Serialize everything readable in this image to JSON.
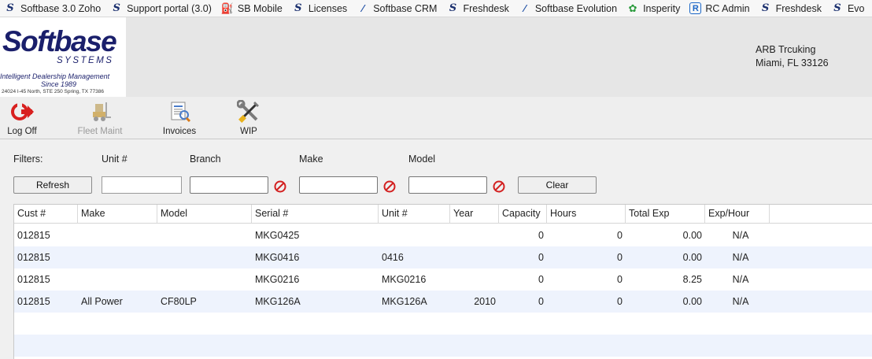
{
  "bookmarks": [
    {
      "label": "Softbase 3.0 Zoho",
      "icon": "softbase-icon"
    },
    {
      "label": "Support portal (3.0)",
      "icon": "softbase-icon"
    },
    {
      "label": "SB Mobile",
      "icon": "forklift-icon"
    },
    {
      "label": "Licenses",
      "icon": "softbase-icon"
    },
    {
      "label": "Softbase CRM",
      "icon": "crm-icon"
    },
    {
      "label": "Freshdesk",
      "icon": "softbase-icon"
    },
    {
      "label": "Softbase Evolution",
      "icon": "crm-icon"
    },
    {
      "label": "Insperity",
      "icon": "insperity-icon"
    },
    {
      "label": "RC Admin",
      "icon": "rc-icon"
    },
    {
      "label": "Freshdesk",
      "icon": "softbase-icon"
    },
    {
      "label": "Evo",
      "icon": "softbase-icon"
    }
  ],
  "logo": {
    "name": "Softbase",
    "subtitle": "SYSTEMS",
    "tagline": "Intelligent Dealership Management",
    "since": "Since 1989",
    "address": "24024 I-45 North, STE 250 Spring, TX 77386"
  },
  "company": {
    "name": "ARB Trcuking",
    "city": "Miami, FL 33126"
  },
  "toolbar": {
    "logoff": "Log Off",
    "fleet_maint": "Fleet Maint",
    "invoices": "Invoices",
    "wip": "WIP"
  },
  "filters": {
    "label": "Filters:",
    "unit_label": "Unit #",
    "branch_label": "Branch",
    "make_label": "Make",
    "model_label": "Model",
    "refresh": "Refresh",
    "clear": "Clear",
    "unit_value": ""
  },
  "table": {
    "columns": [
      "Cust #",
      "Make",
      "Model",
      "Serial #",
      "Unit #",
      "Year",
      "Capacity",
      "Hours",
      "Total Exp",
      "Exp/Hour"
    ],
    "rows": [
      {
        "cust": "012815",
        "make": "",
        "model": "",
        "serial": "MKG0425",
        "unit": "",
        "year": "",
        "capacity": "0",
        "hours": "0",
        "total_exp": "0.00",
        "exp_hour": "N/A"
      },
      {
        "cust": "012815",
        "make": "",
        "model": "",
        "serial": "MKG0416",
        "unit": "0416",
        "year": "",
        "capacity": "0",
        "hours": "0",
        "total_exp": "0.00",
        "exp_hour": "N/A"
      },
      {
        "cust": "012815",
        "make": "",
        "model": "",
        "serial": "MKG0216",
        "unit": "MKG0216",
        "year": "",
        "capacity": "0",
        "hours": "0",
        "total_exp": "8.25",
        "exp_hour": "N/A"
      },
      {
        "cust": "012815",
        "make": "All Power",
        "model": "CF80LP",
        "serial": "MKG126A",
        "unit": "MKG126A",
        "year": "2010",
        "capacity": "0",
        "hours": "0",
        "total_exp": "0.00",
        "exp_hour": "N/A"
      }
    ]
  }
}
